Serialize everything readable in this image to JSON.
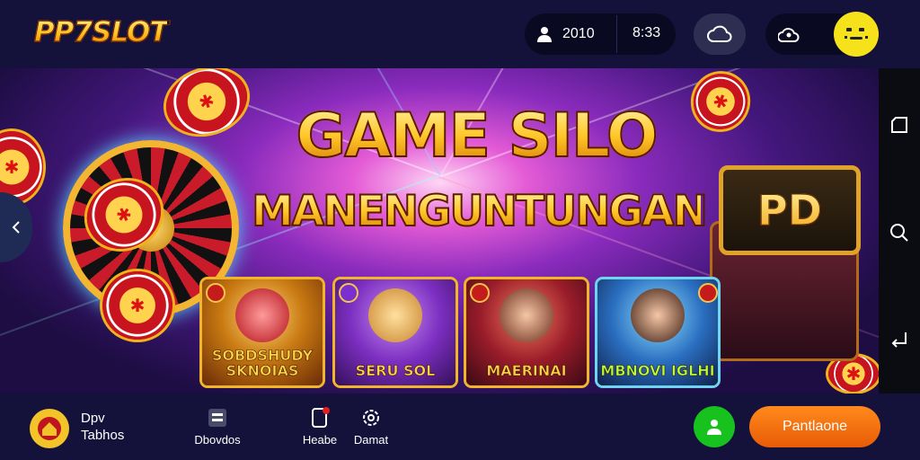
{
  "header": {
    "logo_text": "PP7SLOT",
    "balance_value": "2010",
    "time_value": "8:33",
    "icons": [
      "user-silhouette-icon",
      "cloud-icon",
      "cloud-user-icon",
      "avatar-face-icon"
    ]
  },
  "banner": {
    "headline_line1": "GAME SILO",
    "headline_line2": "MANENGUNTUNGAN",
    "sign_text": "PD",
    "chip_symbol": "✱",
    "cards": [
      {
        "title": "SOBDSHUDY SKNOIAS"
      },
      {
        "title": "SERU SOL"
      },
      {
        "title": "MAERINAI"
      },
      {
        "title": "MBNOVI IGLHI"
      }
    ]
  },
  "sidebar": {
    "icons": [
      "square-icon",
      "search-icon",
      "back-arrow-icon"
    ]
  },
  "bottom_nav": {
    "home_line1": "Dpv",
    "home_line2": "Tabhos",
    "items": [
      {
        "label": "Dbovdos",
        "icon": "grid-icon"
      },
      {
        "label": "Heabe",
        "icon": "phone-icon"
      },
      {
        "label": "Damat",
        "icon": "gear-icon"
      }
    ],
    "cta_label": "Pantlaone",
    "chat_icon": "chat-person-icon"
  },
  "colors": {
    "background": "#14123a",
    "accent_yellow": "#f5e21a",
    "cta_orange": "#f07010",
    "chat_green": "#17c21f"
  }
}
